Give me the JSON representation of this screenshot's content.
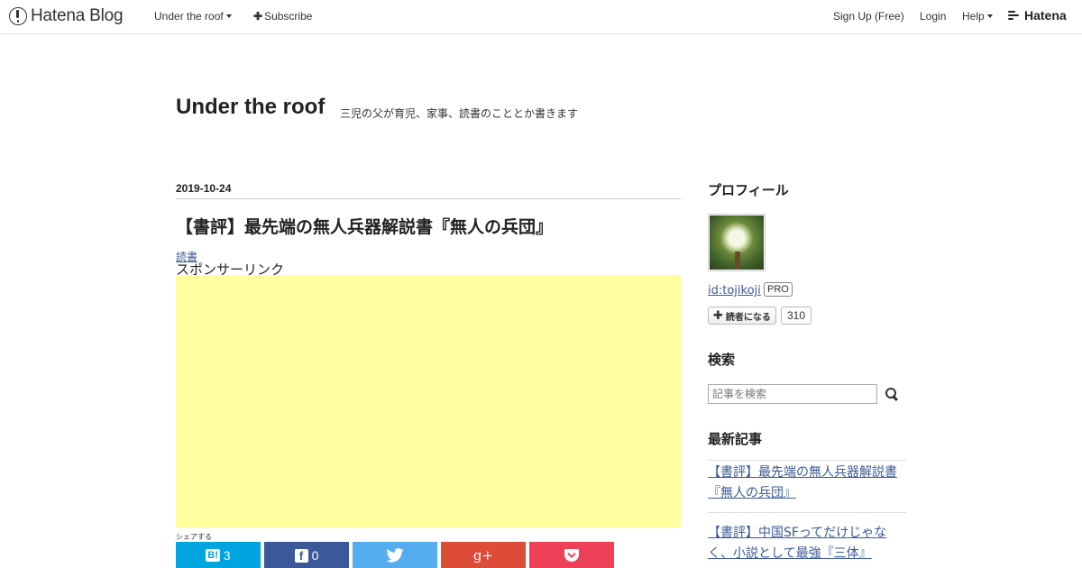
{
  "topbar": {
    "logo_text": "Hatena Blog",
    "blog_menu": "Under the roof",
    "subscribe": "Subscribe",
    "signup": "Sign Up (Free)",
    "login": "Login",
    "help": "Help",
    "brand": "Hatena"
  },
  "blog": {
    "title": "Under the roof",
    "description": "三児の父が育児、家事、読書のこととか書きます"
  },
  "entry": {
    "date": "2019-10-24",
    "title": "【書評】最先端の無人兵器解説書『無人の兵団』",
    "category": "読書",
    "sponsor_label": "スポンサーリンク",
    "share_label": "シェアする",
    "share": {
      "hatena": {
        "icon": "B!",
        "count": "3",
        "color": "#00a4de"
      },
      "facebook": {
        "icon": "f",
        "count": "0",
        "color": "#3b5998"
      },
      "twitter": {
        "color": "#55acee"
      },
      "googleplus": {
        "icon": "g+",
        "color": "#dd4b39"
      },
      "pocket": {
        "color": "#ee4056"
      }
    }
  },
  "sidebar": {
    "profile_heading": "プロフィール",
    "user_id": "id:tojikoji",
    "pro_badge": "PRO",
    "subscribe_label": "読者になる",
    "subscriber_count": "310",
    "search_heading": "検索",
    "search_placeholder": "記事を検索",
    "recent_heading": "最新記事",
    "recent": [
      "【書評】最先端の無人兵器解説書『無人の兵団』",
      "【書評】中国SFってだけじゃなく、小説として最強『三体』"
    ]
  }
}
